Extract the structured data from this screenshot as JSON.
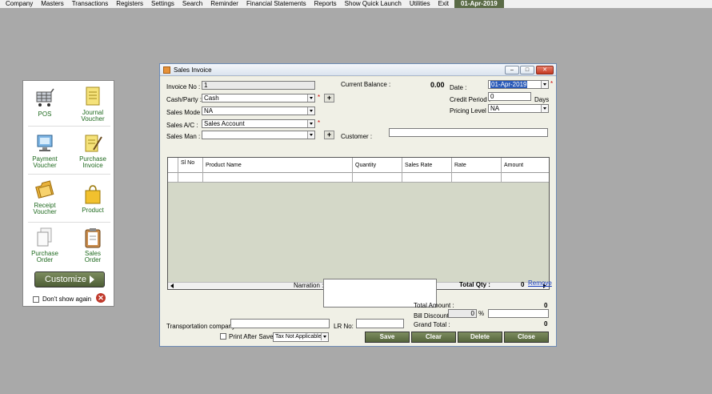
{
  "menubar": {
    "items": [
      "Company",
      "Masters",
      "Transactions",
      "Registers",
      "Settings",
      "Search",
      "Reminder",
      "Financial Statements",
      "Reports",
      "Show Quick Launch",
      "Utilities",
      "Exit"
    ],
    "date": "01-Apr-2019"
  },
  "quick_launch": {
    "items": [
      {
        "label": "POS",
        "icon": "cart-icon"
      },
      {
        "label": "Journal Voucher",
        "icon": "notepad-icon"
      },
      {
        "label": "Payment Voucher",
        "icon": "monitor-icon"
      },
      {
        "label": "Purchase Invoice",
        "icon": "notepad-pen-icon"
      },
      {
        "label": "Receipt Voucher",
        "icon": "folder-icon"
      },
      {
        "label": "Product",
        "icon": "bag-icon"
      },
      {
        "label": "Purchase Order",
        "icon": "documents-icon"
      },
      {
        "label": "Sales Order",
        "icon": "clipboard-icon"
      }
    ],
    "customize_label": "Customize",
    "dont_show_label": "Don't show again"
  },
  "window": {
    "title": "Sales Invoice",
    "invoice_no_label": "Invoice No :",
    "invoice_no": "1",
    "cash_party_label": "Cash/Party :",
    "cash_party": "Cash",
    "sales_mode_label": "Sales Mode :",
    "sales_mode": "NA",
    "sales_ac_label": "Sales A/C :",
    "sales_ac": "Sales Account",
    "sales_man_label": "Sales Man :",
    "sales_man": "",
    "current_balance_label": "Current Balance :",
    "current_balance": "0.00",
    "customer_label": "Customer :",
    "customer": "",
    "date_label": "Date :",
    "date": "01-Apr-2019",
    "credit_period_label": "Credit Period :",
    "credit_period": "0",
    "credit_period_unit": "Days",
    "pricing_level_label": "Pricing Level :",
    "pricing_level": "NA",
    "plus": "+",
    "required_mark": "*",
    "grid": {
      "columns": [
        "Sl No",
        "Product Name",
        "Quantity",
        "Sales Rate",
        "Rate",
        "Amount"
      ]
    },
    "narration_label": "Narration :",
    "total_qty_label": "Total Qty :",
    "total_qty": "0",
    "remove_label": "Remove",
    "total_amount_label": "Total Amount :",
    "total_amount": "0",
    "bill_discount_label": "Bill Discount :",
    "bill_discount_pct": "0",
    "pct_symbol": "%",
    "grand_total_label": "Grand Total :",
    "grand_total": "0",
    "transport_label": "Transportation company:",
    "lr_no_label": "LR No:",
    "print_after_save_label": "Print After Save",
    "tax_option": "Tax Not Applicable",
    "buttons": {
      "save": "Save",
      "clear": "Clear",
      "delete": "Delete",
      "close": "Close"
    }
  }
}
